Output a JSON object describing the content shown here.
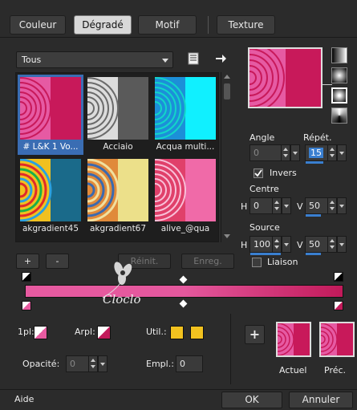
{
  "tabs": [
    {
      "label": "Couleur",
      "active": false
    },
    {
      "label": "Dégradé",
      "active": true
    },
    {
      "label": "Motif",
      "active": false
    },
    {
      "label": "Texture",
      "active": false
    }
  ],
  "category": {
    "selected": "Tous"
  },
  "gallery": {
    "items": [
      {
        "label": "# L&K 1 Vo...",
        "selected": true
      },
      {
        "label": "Acciaio",
        "selected": false
      },
      {
        "label": "Acqua multi...",
        "selected": false
      },
      {
        "label": "akgradient45",
        "selected": false
      },
      {
        "label": "akgradient67",
        "selected": false
      },
      {
        "label": "alive_@qua",
        "selected": false
      }
    ]
  },
  "gallery_buttons": {
    "add": "+",
    "remove": "-",
    "reset": "Réinit.",
    "save": "Enreg."
  },
  "controls": {
    "angle_label": "Angle",
    "angle_value": "0",
    "repeat_label": "Répét.",
    "repeat_value": "15",
    "invert_label": "Invers",
    "invert_checked": true,
    "centre_label": "Centre",
    "centre_h_label": "H",
    "centre_h_value": "0",
    "centre_v_label": "V",
    "centre_v_value": "50",
    "source_label": "Source",
    "source_h_label": "H",
    "source_h_value": "100",
    "source_v_label": "V",
    "source_v_value": "50",
    "link_label": "Liaison",
    "link_checked": false
  },
  "gradient_editor": {
    "fg_label": "1pl:",
    "bg_label": "Arpl:",
    "user_label": "Util.:",
    "opacity_label": "Opacité:",
    "opacity_value": "0",
    "location_label": "Empl.:",
    "location_value": "0"
  },
  "watermark": {
    "text": "Cloclo"
  },
  "colors": {
    "pink": "#e75aa0",
    "magenta": "#c21a5a",
    "yellow": "#f2c21f",
    "accent": "#3a7fd0"
  },
  "compare": {
    "current_label": "Actuel",
    "previous_label": "Préc."
  },
  "footer": {
    "help": "Aide",
    "ok": "OK",
    "cancel": "Annuler"
  }
}
